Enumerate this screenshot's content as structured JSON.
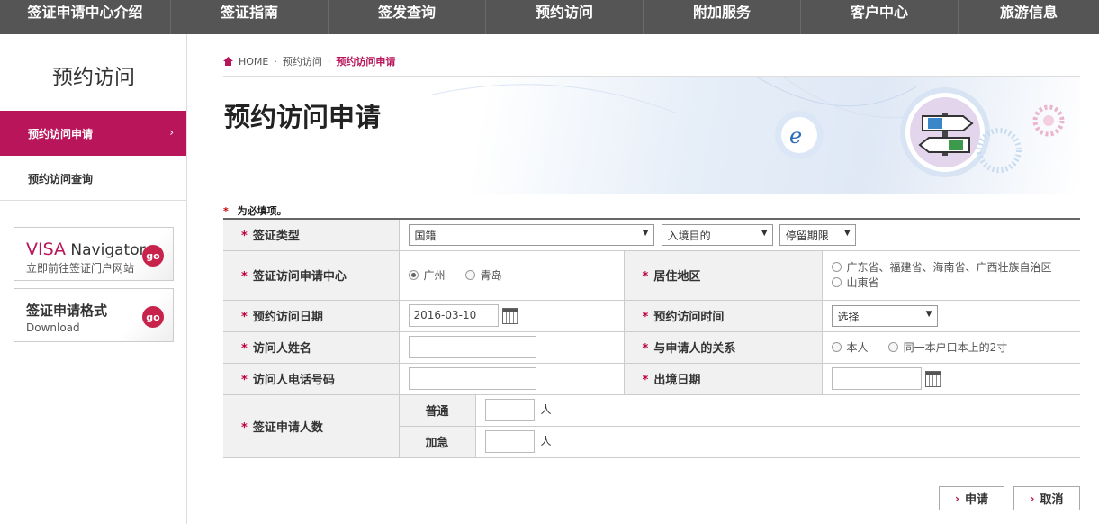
{
  "nav": {
    "items": [
      "签证申请中心介绍",
      "签证指南",
      "签发查询",
      "预约访问",
      "附加服务",
      "客户中心",
      "旅游信息"
    ]
  },
  "sidebar": {
    "title": "预约访问",
    "items": [
      {
        "label": "预约访问申请",
        "chevron": "›"
      },
      {
        "label": "预约访问查询"
      }
    ],
    "promo_visa": {
      "brand": "VISA",
      "line1_rest": " Navigator",
      "line2": "立即前往签证门户网站",
      "go": "go"
    },
    "promo_format": {
      "line1": "签证申请格式",
      "line2": "Download",
      "go": "go"
    }
  },
  "breadcrumb": {
    "home": "HOME",
    "sep": "·",
    "parent": "预约访问",
    "current": "预约访问申请"
  },
  "page_title": "预约访问申请",
  "required_note": {
    "star": "*",
    "text": " 为必填项。"
  },
  "form": {
    "star": "*",
    "visa_type": {
      "label": "签证类型",
      "nationality": "国籍",
      "purpose": "入境目的",
      "stay": "停留期限"
    },
    "center": {
      "label": "签证访问申请中心",
      "opt1": "广州",
      "opt2": "青岛"
    },
    "region": {
      "label": "居住地区",
      "opt1": "广东省、福建省、海南省、广西壮族自治区",
      "opt2": "山東省"
    },
    "date": {
      "label": "预约访问日期",
      "value": "2016-03-10"
    },
    "time": {
      "label": "预约访问时间",
      "value": "选择"
    },
    "name": {
      "label": "访问人姓名"
    },
    "relation": {
      "label": "与申请人的关系",
      "opt1": "本人",
      "opt2": "同一本户口本上的2寸"
    },
    "phone": {
      "label": "访问人电话号码"
    },
    "depart": {
      "label": "出境日期"
    },
    "count": {
      "label": "签证申请人数",
      "normal": "普通",
      "urgent": "加急",
      "unit": "人"
    }
  },
  "buttons": {
    "apply": "申请",
    "cancel": "取消",
    "icon": "›"
  },
  "colors": {
    "accent": "#b8155a",
    "nav_bg": "#555555",
    "go_badge": "#c7234b"
  },
  "icons": [
    "home-icon",
    "ie-icon",
    "signpost-icon",
    "calendar-icon",
    "chevron-right-icon"
  ]
}
